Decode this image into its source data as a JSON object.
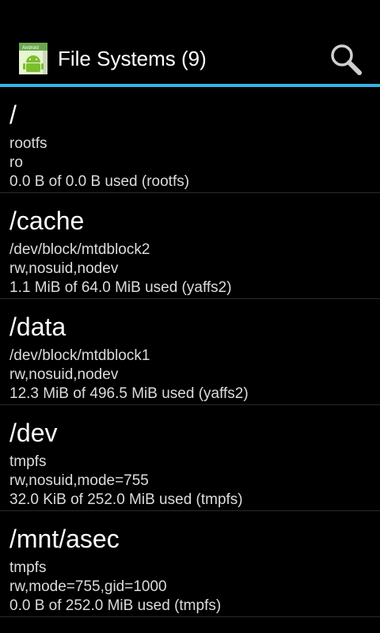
{
  "app": {
    "title": "File Systems (9)",
    "icon_name": "android-app-icon",
    "icon_label": "Android"
  },
  "toolbar": {
    "search_icon": "search-icon"
  },
  "colors": {
    "background": "#000000",
    "accent": "#33b5e5",
    "text_primary": "#ffffff",
    "text_secondary": "#dcdcdc"
  },
  "filesystems": [
    {
      "mount": "/",
      "device": "rootfs",
      "options": "ro",
      "usage": "0.0 B of 0.0 B used (rootfs)"
    },
    {
      "mount": "/cache",
      "device": "/dev/block/mtdblock2",
      "options": "rw,nosuid,nodev",
      "usage": "1.1 MiB of 64.0 MiB used (yaffs2)"
    },
    {
      "mount": "/data",
      "device": "/dev/block/mtdblock1",
      "options": "rw,nosuid,nodev",
      "usage": "12.3 MiB of 496.5 MiB used (yaffs2)"
    },
    {
      "mount": "/dev",
      "device": "tmpfs",
      "options": "rw,nosuid,mode=755",
      "usage": "32.0 KiB of 252.0 MiB used (tmpfs)"
    },
    {
      "mount": "/mnt/asec",
      "device": "tmpfs",
      "options": "rw,mode=755,gid=1000",
      "usage": "0.0 B of 252.0 MiB used (tmpfs)"
    }
  ]
}
